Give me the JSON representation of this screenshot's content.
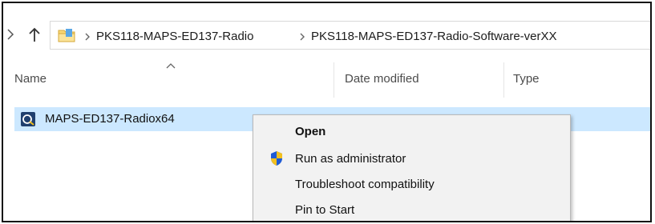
{
  "breadcrumb": {
    "items": [
      {
        "label": "PKS118-MAPS-ED137-Radio"
      },
      {
        "label": "PKS118-MAPS-ED137-Radio-Software-verXX"
      }
    ]
  },
  "columns": {
    "name": "Name",
    "date_modified": "Date modified",
    "type": "Type"
  },
  "file": {
    "name": "MAPS-ED137-Radiox64",
    "date_modified": "",
    "type": ""
  },
  "context_menu": {
    "items": [
      {
        "label": "Open",
        "bold": true
      },
      {
        "label": "Run as administrator",
        "icon": "uac-shield-icon"
      },
      {
        "label": "Troubleshoot compatibility"
      },
      {
        "label": "Pin to Start"
      }
    ]
  },
  "colors": {
    "selection": "#cce8ff",
    "menu_bg": "#f2f2f2",
    "folder": "#f8d775",
    "shield_blue": "#1e5bd6",
    "shield_yellow": "#f2c01f"
  }
}
